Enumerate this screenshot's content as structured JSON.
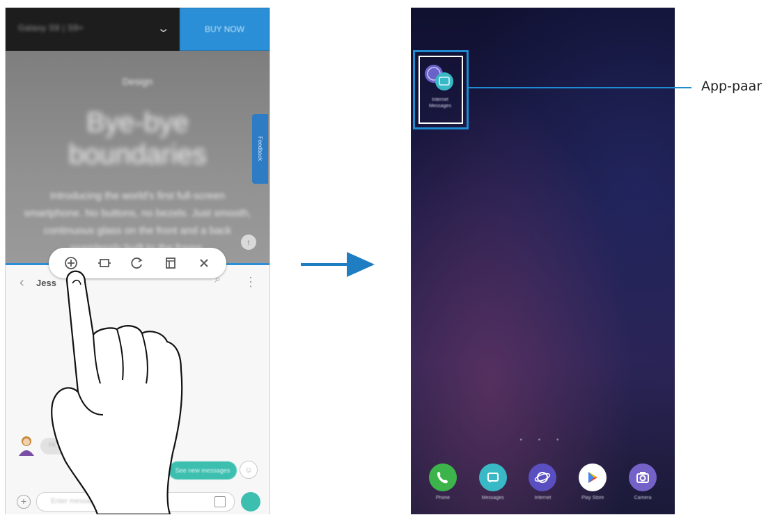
{
  "colors": {
    "accent_blue": "#1f8bd3",
    "web_topbar": "#1d1d1d",
    "cta_blue": "#2a8fd6",
    "message_teal": "#3dbfb0",
    "home_background": "#1d1b48"
  },
  "left_phone": {
    "web_pane": {
      "model_text": "Galaxy S9 | S9+",
      "cta_text": "BUY NOW",
      "kicker": "Design",
      "hero_line1": "Bye-bye",
      "hero_line2": "boundaries",
      "paragraph": "Introducing the world's first full-screen smartphone. No buttons, no bezels. Just smooth, continuous glass on the front and a back seamlessly built to the frame.",
      "side_tab_text": "Feedback"
    },
    "messages_pane": {
      "contact_name": "Jess",
      "incoming_text": "Hi",
      "outgoing_text": "See new messages",
      "input_placeholder": "Enter message"
    },
    "toolbar": {
      "icons": [
        "add-app-pair-icon",
        "snap-window-icon",
        "swap-windows-icon",
        "stack-window-icon",
        "close-icon"
      ]
    }
  },
  "right_phone": {
    "app_pair": {
      "label_line1": "Internet",
      "label_line2": "Messages"
    },
    "dock": [
      {
        "label": "Phone",
        "icon": "phone-icon",
        "color": "#3cb44b"
      },
      {
        "label": "Messages",
        "icon": "messages-icon",
        "color": "#39b9c6"
      },
      {
        "label": "Internet",
        "icon": "internet-icon",
        "color": "#5a4fc0"
      },
      {
        "label": "Play Store",
        "icon": "play-store-icon",
        "color": "#ffffff"
      },
      {
        "label": "Camera",
        "icon": "camera-icon",
        "color": "#7562c8"
      }
    ]
  },
  "callout": {
    "label": "App-paar"
  }
}
